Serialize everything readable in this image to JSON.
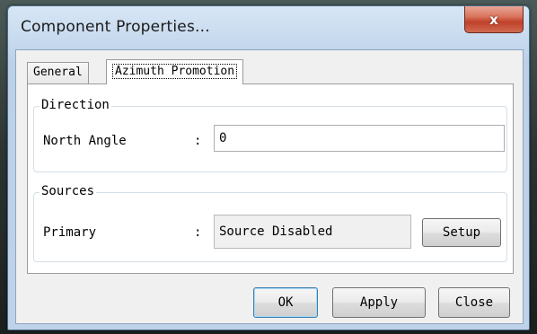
{
  "window": {
    "title": "Component Properties...",
    "close_glyph": "x"
  },
  "tabs": [
    {
      "label": "General",
      "selected": false
    },
    {
      "label": "Azimuth Promotion",
      "selected": true
    }
  ],
  "direction": {
    "legend": "Direction",
    "north_angle_label": "North Angle",
    "colon": ":",
    "north_angle_value": "0"
  },
  "sources": {
    "legend": "Sources",
    "primary_label": "Primary",
    "colon": ":",
    "primary_value": "Source Disabled",
    "setup_label": "Setup"
  },
  "buttons": {
    "ok": "OK",
    "apply": "Apply",
    "close": "Close"
  },
  "colors": {
    "title_bar": "#c6d9ee",
    "close_button": "#c0412a",
    "panel_bg": "#f0f0f0"
  },
  "icons": {
    "close": "close-icon"
  }
}
